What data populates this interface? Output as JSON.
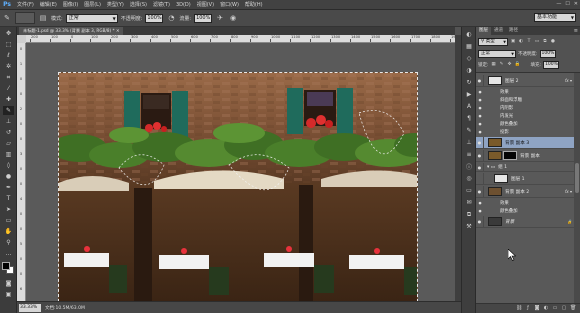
{
  "menubar": {
    "logo": "Ps",
    "items": [
      "文件(F)",
      "编辑(E)",
      "图像(I)",
      "图层(L)",
      "类型(Y)",
      "选择(S)",
      "滤镜(T)",
      "3D(D)",
      "视图(V)",
      "窗口(W)",
      "帮助(H)"
    ],
    "window_controls": [
      "—",
      "☐",
      "✕"
    ]
  },
  "options": {
    "mode_label": "模式:",
    "mode_value": "正常",
    "opacity_label": "不透明度:",
    "opacity_value": "100%",
    "flow_label": "流量:",
    "flow_value": "100%",
    "workspace": "基本功能"
  },
  "document": {
    "tab_title": "未标题-1.psd @ 33.3% (背景 副本 3, RGB/8) *",
    "zoom": "33.33%",
    "info": "文档:10.5M/63.0M"
  },
  "ruler": {
    "top_ticks": [
      "200",
      "100",
      "0",
      "100",
      "200",
      "300",
      "400",
      "500",
      "600",
      "700",
      "800",
      "900",
      "1000",
      "1100",
      "1200",
      "1300",
      "1400",
      "1500",
      "1600",
      "1700",
      "1800",
      "1900"
    ],
    "left_ticks": [
      "0",
      "1",
      "0",
      "0",
      "2",
      "0",
      "0",
      "3",
      "0",
      "0",
      "4",
      "0",
      "0",
      "5",
      "0",
      "0",
      "6"
    ]
  },
  "panel": {
    "tabs": [
      "图层",
      "通道",
      "路径"
    ],
    "filter_kind": "类型",
    "blend_mode": "正常",
    "opacity_label": "不透明度:",
    "opacity_value": "100%",
    "lock_label": "锁定:",
    "fill_label": "填充:",
    "fill_value": "100%"
  },
  "layers": [
    {
      "name": "图层 2",
      "type": "layer",
      "thumb": "#e6e6e6",
      "fx": true,
      "selected": false
    },
    {
      "name": "效果",
      "type": "fx"
    },
    {
      "name": "斜面和浮雕",
      "type": "fx"
    },
    {
      "name": "内阴影",
      "type": "fx"
    },
    {
      "name": "内发光",
      "type": "fx"
    },
    {
      "name": "颜色叠加",
      "type": "fx"
    },
    {
      "name": "投影",
      "type": "fx"
    },
    {
      "name": "背景 副本 3",
      "type": "layer",
      "thumb": "#7a5a2a",
      "fx": false,
      "selected": true
    },
    {
      "name": "背景 副本",
      "type": "masked",
      "thumb": "#7a5a2a",
      "fx": false,
      "selected": false
    },
    {
      "name": "组 1",
      "type": "group"
    },
    {
      "name": "图层 1",
      "type": "layer",
      "thumb": "#e6e6e6",
      "fx": false,
      "selected": false
    },
    {
      "name": "背景 副本 2",
      "type": "layer",
      "thumb": "#6d5030",
      "fx": true,
      "selected": false
    },
    {
      "name": "效果",
      "type": "fx"
    },
    {
      "name": "颜色叠加",
      "type": "fx"
    },
    {
      "name": "背景",
      "type": "layer",
      "thumb": "#3a3a3a",
      "fx": false,
      "selected": false
    }
  ],
  "colors": {
    "ui_dark": "#424242",
    "ui_panel": "#525252",
    "selected_layer": "#8fa4c4",
    "brick": "#8a5a3a",
    "shutter": "#1f6b5c",
    "ivy": "#3f6f24",
    "awning": "#d9cdb8"
  },
  "icons": {
    "tools": [
      "move-icon",
      "marquee-icon",
      "lasso-icon",
      "quick-select-icon",
      "crop-icon",
      "eyedropper-icon",
      "healing-icon",
      "brush-icon",
      "clone-stamp-icon",
      "history-brush-icon",
      "eraser-icon",
      "gradient-icon",
      "blur-icon",
      "dodge-icon",
      "pen-icon",
      "type-icon",
      "path-select-icon",
      "shape-icon",
      "hand-icon",
      "zoom-icon"
    ]
  }
}
